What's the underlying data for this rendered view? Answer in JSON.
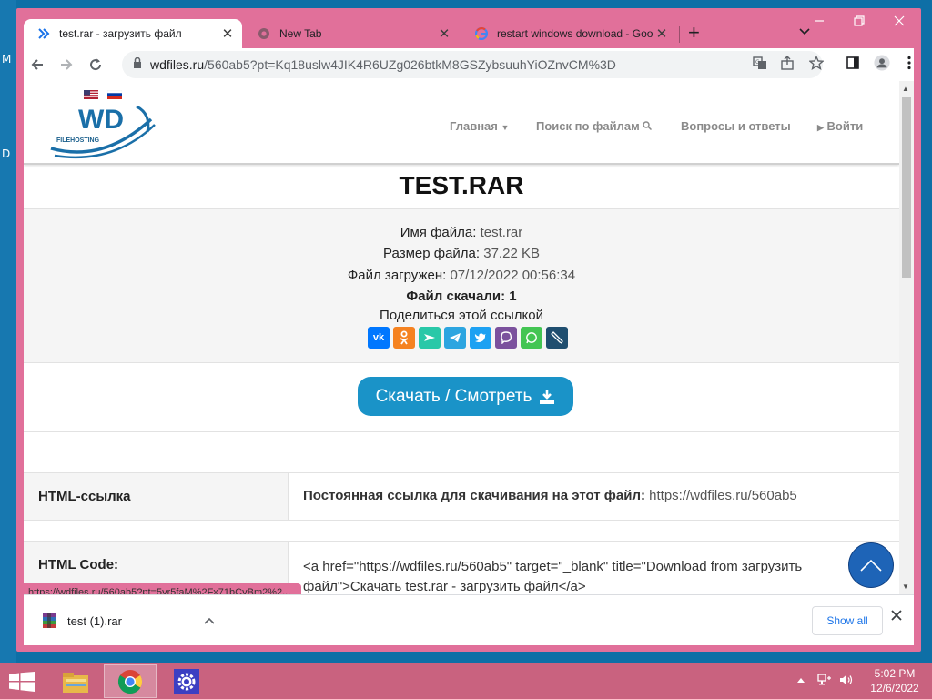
{
  "desktop": {
    "glyph_1": "M",
    "glyph_2": "D"
  },
  "browser": {
    "tabs": [
      {
        "title": "test.rar - загрузить файл",
        "active": true
      },
      {
        "title": "New Tab",
        "active": false
      },
      {
        "title": "restart windows download - Goo",
        "active": false
      }
    ],
    "new_tab_label": "+",
    "address": {
      "domain": "wdfiles.ru",
      "path": "/560ab5?pt=Kq18uslw4JIK4R6UZg026btkM8GSZybsuuhYiOZnvCM%3D"
    },
    "status_url": "https://wdfiles.ru/560ab5?pt=5vr5faM%2Fx71bCvBm2%2..."
  },
  "site": {
    "logo_text": "WD",
    "logo_sub": "FILEHOSTING",
    "nav": {
      "home": "Главная",
      "search": "Поиск по файлам",
      "faq": "Вопросы и ответы",
      "login": "Войти"
    },
    "title": "TEST.RAR",
    "info": {
      "name_label": "Имя файла:",
      "name_value": "test.rar",
      "size_label": "Размер файла:",
      "size_value": "37.22 KB",
      "uploaded_label": "Файл загружен:",
      "uploaded_value": "07/12/2022 00:56:34",
      "downloads_label": "Файл скачали:",
      "downloads_value": "1",
      "share_label": "Поделиться этой ссылкой"
    },
    "download_button": "Скачать / Смотреть",
    "rows": [
      {
        "key": "HTML-ссылка",
        "bold": "Постоянная ссылка для скачивания на этот файл:",
        "value": "https://wdfiles.ru/560ab5"
      },
      {
        "key": "HTML Code:",
        "line1": "<a href=\"https://wdfiles.ru/560ab5\" target=\"_blank\" title=\"Download from загрузить",
        "line2": "файл\">Скачать test.rar - загрузить файл</a>"
      }
    ]
  },
  "downloads_shelf": {
    "file": "test (1).rar",
    "show_all": "Show all"
  },
  "taskbar": {
    "time": "5:02 PM",
    "date": "12/6/2022"
  },
  "colors": {
    "frame": "#e1709a",
    "download_button": "#1a93c8",
    "to_top": "#1e64b7",
    "taskbar": "#c9627f"
  }
}
